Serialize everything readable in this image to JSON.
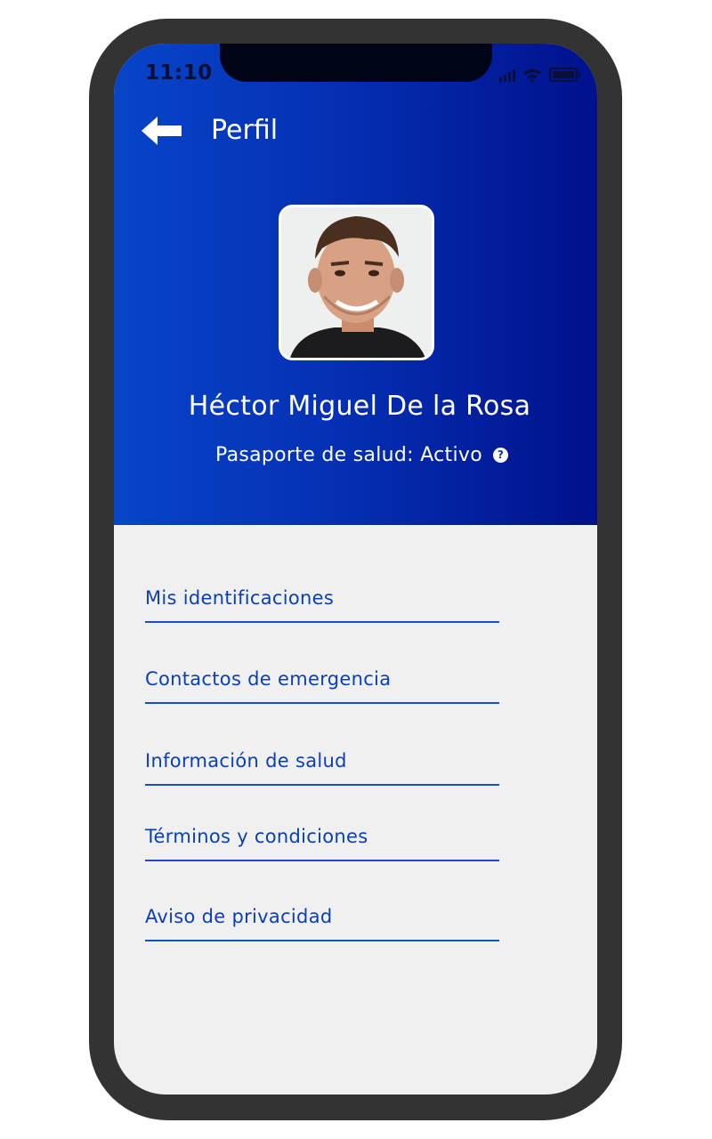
{
  "status_bar": {
    "time": "11:10"
  },
  "header": {
    "title": "Perfil",
    "back_icon": "arrow-left-icon"
  },
  "profile": {
    "name": "Héctor Miguel De la Rosa",
    "passport_status": "Pasaporte de salud: Activo",
    "help_icon_glyph": "?"
  },
  "menu": {
    "items": [
      {
        "label": "Mis identificaciones"
      },
      {
        "label": "Contactos de emergencia"
      },
      {
        "label": "Información de salud"
      },
      {
        "label": "Términos y condiciones"
      },
      {
        "label": "Aviso de privacidad"
      }
    ]
  },
  "colors": {
    "header_gradient_start": "#0745c8",
    "header_gradient_end": "#00118c",
    "link": "#0b3fb5",
    "background": "#f0f0f1",
    "phone_frame": "#333333"
  }
}
